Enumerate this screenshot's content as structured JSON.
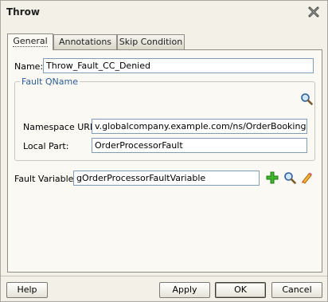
{
  "dialog": {
    "title": "Throw"
  },
  "tabs": [
    {
      "label": "General",
      "active": true
    },
    {
      "label": "Annotations",
      "active": false
    },
    {
      "label": "Skip Condition",
      "active": false
    }
  ],
  "general": {
    "name_label": "Name:",
    "name_value": "Throw_Fault_CC_Denied",
    "fault_qname": {
      "title": "Fault QName",
      "namespace_label": "Namespace URI:",
      "namespace_value": "v.globalcompany.example.com/ns/OrderBookingService",
      "local_part_label": "Local Part:",
      "local_part_value": "OrderProcessorFault"
    },
    "fault_variable_label": "Fault Variable:",
    "fault_variable_value": "gOrderProcessorFaultVariable"
  },
  "icons": {
    "close": "close-icon",
    "qname_search": "search-icon",
    "variable_add": "add-icon",
    "variable_search": "search-icon",
    "variable_edit": "edit-icon"
  },
  "buttons": {
    "help": "Help",
    "apply": "Apply",
    "ok": "OK",
    "cancel": "Cancel"
  },
  "colors": {
    "group_title": "#2c5d9c",
    "add_icon": "#2f9a1f"
  }
}
